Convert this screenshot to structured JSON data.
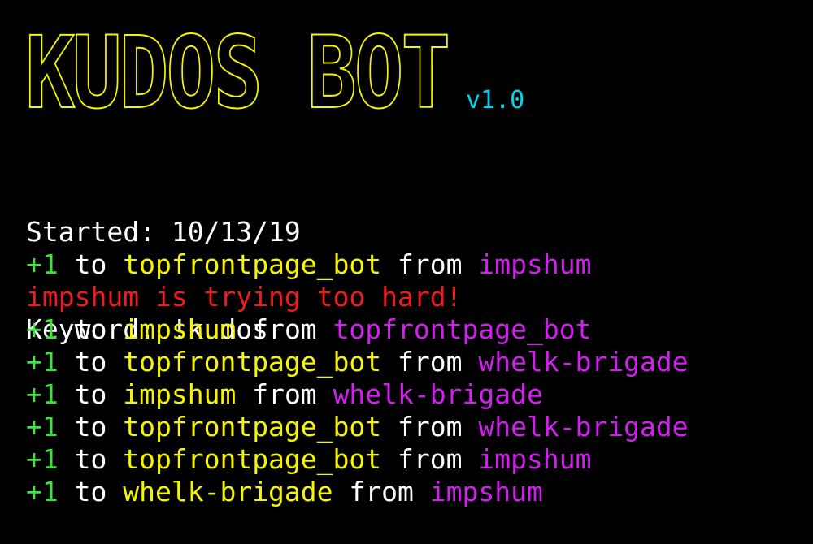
{
  "banner": {
    "title": "KUDOS BOT",
    "version": "v1.0"
  },
  "info": {
    "started_label": "Started:",
    "started_value": "10/13/19",
    "keyword_label": "Keyword:",
    "keyword_value": "!kudos"
  },
  "log": [
    {
      "type": "kudos",
      "plus": "+1",
      "to": "to",
      "recipient": "topfrontpage_bot",
      "from": "from",
      "sender": "impshum"
    },
    {
      "type": "warning",
      "text": "impshum is trying too hard!"
    },
    {
      "type": "kudos",
      "plus": "+1",
      "to": "to",
      "recipient": "impshum",
      "from": "from",
      "sender": "topfrontpage_bot"
    },
    {
      "type": "kudos",
      "plus": "+1",
      "to": "to",
      "recipient": "topfrontpage_bot",
      "from": "from",
      "sender": "whelk-brigade"
    },
    {
      "type": "kudos",
      "plus": "+1",
      "to": "to",
      "recipient": "impshum",
      "from": "from",
      "sender": "whelk-brigade"
    },
    {
      "type": "kudos",
      "plus": "+1",
      "to": "to",
      "recipient": "topfrontpage_bot",
      "from": "from",
      "sender": "whelk-brigade"
    },
    {
      "type": "kudos",
      "plus": "+1",
      "to": "to",
      "recipient": "topfrontpage_bot",
      "from": "from",
      "sender": "impshum"
    },
    {
      "type": "kudos",
      "plus": "+1",
      "to": "to",
      "recipient": "whelk-brigade",
      "from": "from",
      "sender": "impshum"
    }
  ],
  "colors": {
    "background": "#000000",
    "banner": "#f5f500",
    "version": "#00d4ee",
    "plus": "#3ce43c",
    "recipient": "#f5f500",
    "sender": "#d21eef",
    "warning": "#ee1c1c",
    "text": "#ffffff"
  }
}
